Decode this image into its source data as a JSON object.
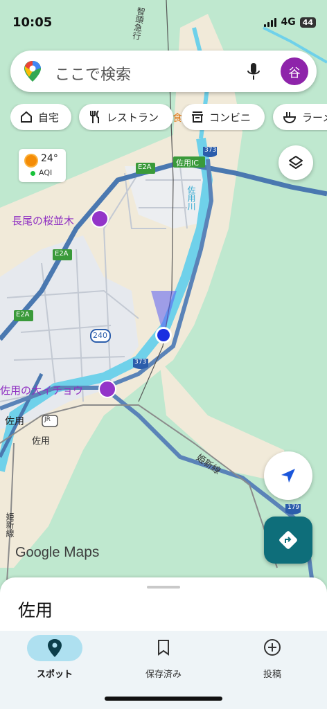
{
  "status": {
    "time": "10:05",
    "network": "4G",
    "battery": "44"
  },
  "search": {
    "placeholder": "ここで検索",
    "avatar_letter": "谷"
  },
  "chips": [
    {
      "icon": "home-icon",
      "label": "自宅"
    },
    {
      "icon": "restaurant-icon",
      "label": "レストラン"
    },
    {
      "icon": "store-icon",
      "label": "コンビニ"
    },
    {
      "icon": "ramen-icon",
      "label": "ラーメ"
    }
  ],
  "weather": {
    "temp": "24°",
    "aqi": "AQI"
  },
  "map_labels": {
    "sakura": "長尾の桜並木",
    "icho": "佐用の大イチョウ",
    "station": "佐用",
    "town": "佐用",
    "ic": "佐用IC",
    "river": "佐用川",
    "line_top": "智頭急行",
    "line_right": "姫新線",
    "line_left": "姫新線",
    "shop": "食",
    "e2a": "E2A",
    "r373": "373",
    "r240": "240",
    "r179": "179",
    "jr": "JR"
  },
  "watermark": {
    "brand": "Google",
    "product": "Maps"
  },
  "sheet": {
    "place": "佐用"
  },
  "nav": [
    {
      "icon": "explore-pin-icon",
      "label": "スポット",
      "active": true
    },
    {
      "icon": "bookmark-icon",
      "label": "保存済み",
      "active": false
    },
    {
      "icon": "add-circle-icon",
      "label": "投稿",
      "active": false
    }
  ],
  "colors": {
    "accent": "#0e6e7a",
    "avatar": "#8e24aa",
    "poi": "#9334c9",
    "road": "#4f7fb8",
    "river": "#45c3e0"
  }
}
